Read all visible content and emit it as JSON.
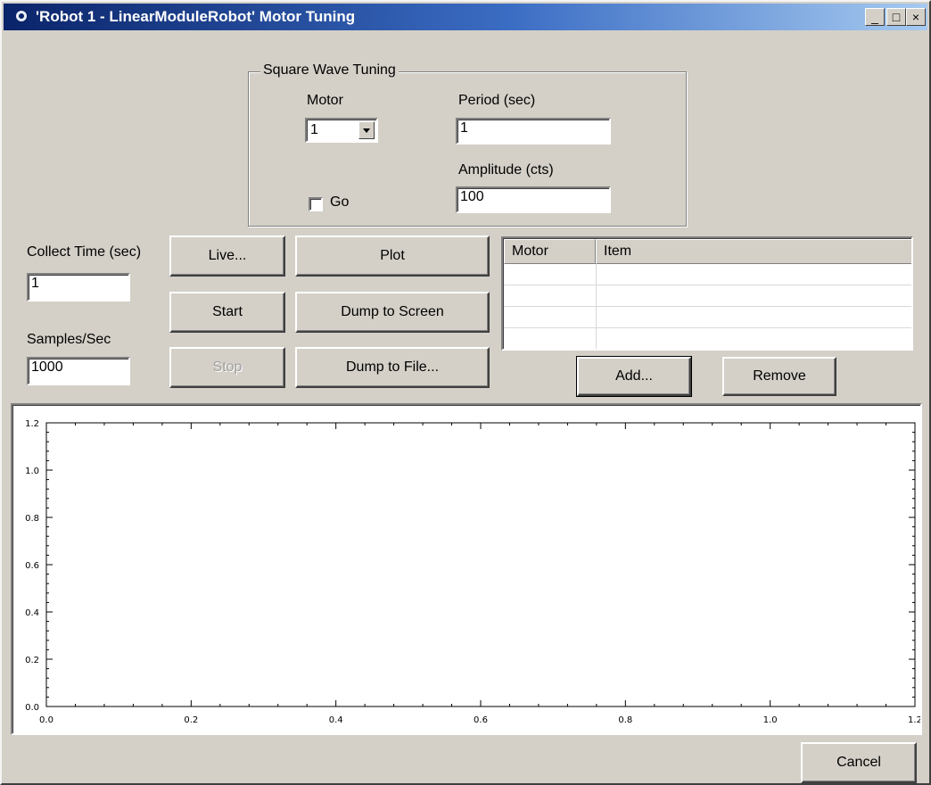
{
  "window": {
    "title": "'Robot 1 - LinearModuleRobot' Motor Tuning",
    "controls": {
      "minimize": "_",
      "maximize": "□",
      "close": "×"
    }
  },
  "square_wave": {
    "group_title": "Square Wave Tuning",
    "motor_label": "Motor",
    "motor_value": "1",
    "period_label": "Period (sec)",
    "period_value": "1",
    "amplitude_label": "Amplitude (cts)",
    "amplitude_value": "100",
    "go_label": "Go",
    "go_checked": false
  },
  "collect": {
    "collect_time_label": "Collect Time (sec)",
    "collect_time_value": "1",
    "samples_label": "Samples/Sec",
    "samples_value": "1000"
  },
  "buttons": {
    "live": "Live...",
    "start": "Start",
    "stop": "Stop",
    "plot": "Plot",
    "dump_screen": "Dump to Screen",
    "dump_file": "Dump to File...",
    "add": "Add...",
    "remove": "Remove",
    "cancel": "Cancel"
  },
  "grid": {
    "columns": [
      "Motor",
      "Item"
    ],
    "rows": [
      [
        "",
        ""
      ],
      [
        "",
        ""
      ],
      [
        "",
        ""
      ],
      [
        "",
        ""
      ]
    ]
  },
  "chart_data": {
    "type": "line",
    "series": [],
    "xlim": [
      0.0,
      1.2
    ],
    "ylim": [
      0.0,
      1.2
    ],
    "x_ticks": [
      "0.0",
      "0.2",
      "0.4",
      "0.6",
      "0.8",
      "1.0",
      "1.2"
    ],
    "y_ticks": [
      "0.0",
      "0.2",
      "0.4",
      "0.6",
      "0.8",
      "1.0",
      "1.2"
    ],
    "grid": false
  }
}
